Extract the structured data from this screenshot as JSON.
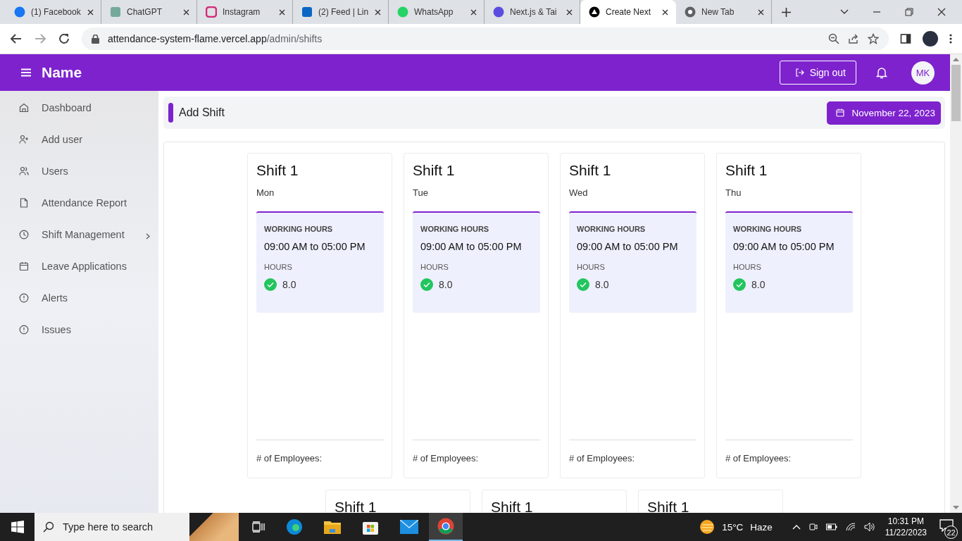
{
  "browser": {
    "tabs": [
      {
        "title": "(1) Facebook",
        "kind": "facebook",
        "selected": false
      },
      {
        "title": "ChatGPT",
        "kind": "chatgpt",
        "selected": false
      },
      {
        "title": "Instagram",
        "kind": "instagram",
        "selected": false
      },
      {
        "title": "(2) Feed | Lin",
        "kind": "linkedin",
        "selected": false
      },
      {
        "title": "WhatsApp",
        "kind": "whatsapp",
        "selected": false
      },
      {
        "title": "Next.js & Tai",
        "kind": "stripes",
        "selected": false
      },
      {
        "title": "Create Next",
        "kind": "triangle",
        "selected": true
      },
      {
        "title": "New Tab",
        "kind": "chrome",
        "selected": false
      }
    ],
    "address": {
      "host": "attendance-system-flame.vercel.app",
      "path": "/admin/shifts"
    }
  },
  "header": {
    "brand": "Name",
    "sign_out": "Sign out",
    "avatar": "MK"
  },
  "sidebar": {
    "items": [
      {
        "label": "Dashboard",
        "kind": "home",
        "has_submenu": false
      },
      {
        "label": "Add user",
        "kind": "user-plus",
        "has_submenu": false
      },
      {
        "label": "Users",
        "kind": "users",
        "has_submenu": false
      },
      {
        "label": "Attendance Report",
        "kind": "file",
        "has_submenu": false
      },
      {
        "label": "Shift Management",
        "kind": "clock",
        "has_submenu": true
      },
      {
        "label": "Leave Applications",
        "kind": "calendar",
        "has_submenu": false
      },
      {
        "label": "Alerts",
        "kind": "alert",
        "has_submenu": false
      },
      {
        "label": "Issues",
        "kind": "alert",
        "has_submenu": false
      }
    ]
  },
  "page_title": "Add Shift",
  "date": "November 22, 2023",
  "shift_rows": [
    [
      {
        "title": "Shift 1",
        "day": "Mon",
        "working_hours_label": "WORKING HOURS",
        "working_hours": "09:00 AM to 05:00 PM",
        "hours_label": "HOURS",
        "hours": "8.0",
        "employees_label": "# of Employees:"
      },
      {
        "title": "Shift 1",
        "day": "Tue",
        "working_hours_label": "WORKING HOURS",
        "working_hours": "09:00 AM to 05:00 PM",
        "hours_label": "HOURS",
        "hours": "8.0",
        "employees_label": "# of Employees:"
      },
      {
        "title": "Shift 1",
        "day": "Wed",
        "working_hours_label": "WORKING HOURS",
        "working_hours": "09:00 AM to 05:00 PM",
        "hours_label": "HOURS",
        "hours": "8.0",
        "employees_label": "# of Employees:"
      },
      {
        "title": "Shift 1",
        "day": "Thu",
        "working_hours_label": "WORKING HOURS",
        "working_hours": "09:00 AM to 05:00 PM",
        "hours_label": "HOURS",
        "hours": "8.0",
        "employees_label": "# of Employees:"
      }
    ],
    [
      {
        "title": "Shift 1"
      },
      {
        "title": "Shift 1"
      },
      {
        "title": "Shift 1"
      }
    ]
  ],
  "taskbar": {
    "search_placeholder": "Type here to search",
    "temperature": "15°C",
    "weather": "Haze",
    "time": "10:31 PM",
    "date": "11/22/2023",
    "notifications": "22"
  }
}
